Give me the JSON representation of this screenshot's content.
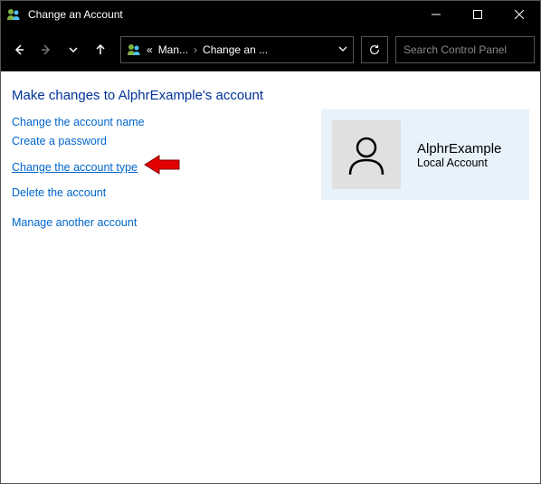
{
  "titlebar": {
    "title": "Change an Account"
  },
  "breadcrumb": {
    "prefix": "«",
    "item1": "Man...",
    "item2": "Change an ..."
  },
  "search": {
    "placeholder": "Search Control Panel"
  },
  "heading": "Make changes to AlphrExample's account",
  "links": {
    "change_name": "Change the account name",
    "create_password": "Create a password",
    "change_type": "Change the account type",
    "delete_account": "Delete the account",
    "manage_another": "Manage another account"
  },
  "account": {
    "name": "AlphrExample",
    "type": "Local Account"
  }
}
